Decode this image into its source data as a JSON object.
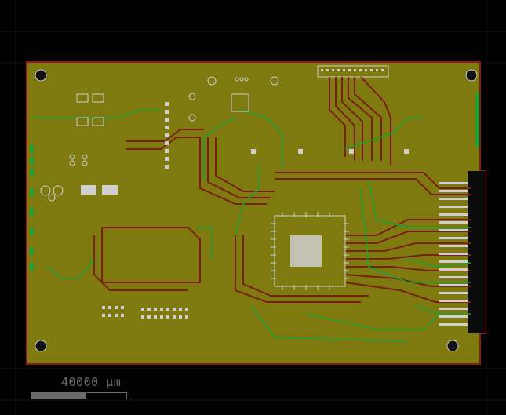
{
  "viewer": {
    "background_color": "#000000",
    "board_color": "#7f7a10",
    "board_outline_color": "#8a1c1c",
    "trace_colors": {
      "top_copper": "#7a1e14",
      "bottom_copper": "#1fa033",
      "silk": "#cfcfcf"
    }
  },
  "scale_bar": {
    "label": "40000 µm",
    "fill_fraction": 0.58
  },
  "icons": [
    "mounting-hole-icon",
    "ic-chip-icon",
    "edge-connector-icon",
    "header-connector-icon"
  ]
}
